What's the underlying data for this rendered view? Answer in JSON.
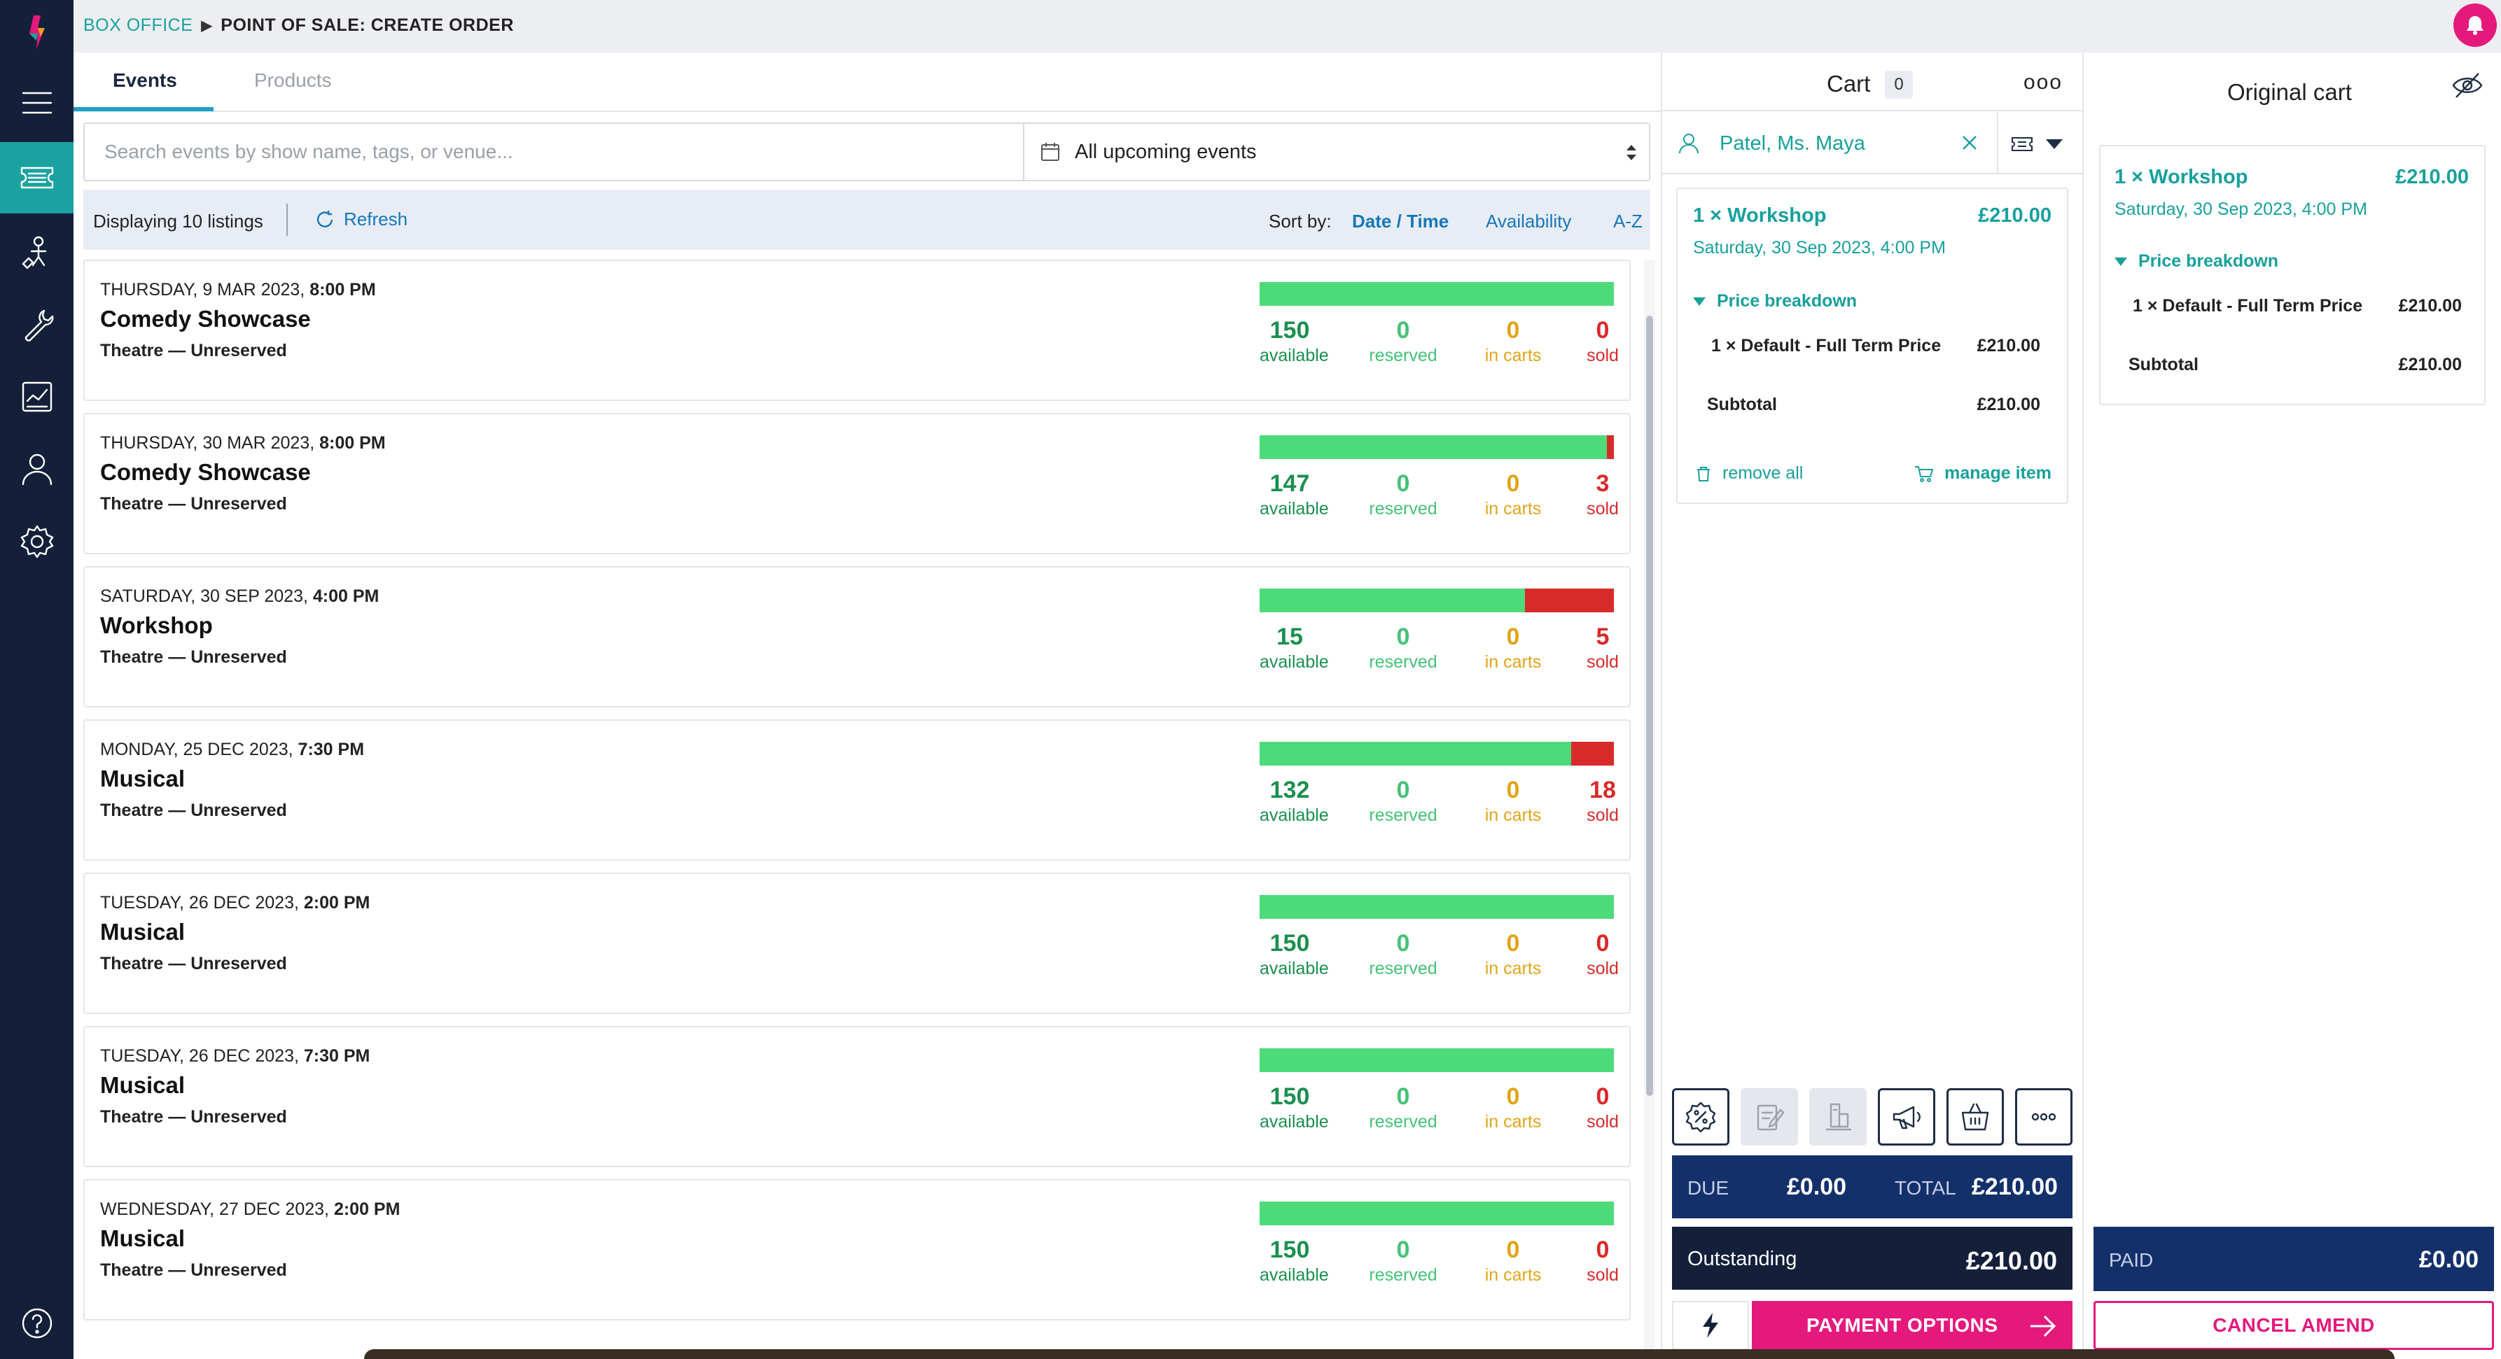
{
  "breadcrumb": {
    "section": "BOX OFFICE",
    "page": "POINT OF SALE: CREATE ORDER"
  },
  "tabs": [
    {
      "label": "Events"
    },
    {
      "label": "Products"
    }
  ],
  "search": {
    "placeholder": "Search events by show name, tags, or venue...",
    "value": ""
  },
  "filter": {
    "selected": "All upcoming events"
  },
  "listing": {
    "count_text": "Displaying 10 listings",
    "refresh_label": "Refresh"
  },
  "sort": {
    "label": "Sort by:",
    "options": [
      "Date / Time",
      "Availability",
      "A-Z"
    ],
    "selected": "Date / Time"
  },
  "stat_labels": {
    "available": "available",
    "reserved": "reserved",
    "in_carts": "in carts",
    "sold": "sold"
  },
  "events": [
    {
      "day": "THURSDAY, 9 MAR 2023,",
      "time": "8:00 PM",
      "name": "Comedy Showcase",
      "venue": "Theatre — Unreserved",
      "available": "150",
      "reserved": "0",
      "in_carts": "0",
      "sold": "0",
      "sold_fraction": 0
    },
    {
      "day": "THURSDAY, 30 MAR 2023,",
      "time": "8:00 PM",
      "name": "Comedy Showcase",
      "venue": "Theatre — Unreserved",
      "available": "147",
      "reserved": "0",
      "in_carts": "0",
      "sold": "3",
      "sold_fraction": 0.02
    },
    {
      "day": "SATURDAY, 30 SEP 2023,",
      "time": "4:00 PM",
      "name": "Workshop",
      "venue": "Theatre — Unreserved",
      "available": "15",
      "reserved": "0",
      "in_carts": "0",
      "sold": "5",
      "sold_fraction": 0.25
    },
    {
      "day": "MONDAY, 25 DEC 2023,",
      "time": "7:30 PM",
      "name": "Musical",
      "venue": "Theatre — Unreserved",
      "available": "132",
      "reserved": "0",
      "in_carts": "0",
      "sold": "18",
      "sold_fraction": 0.12
    },
    {
      "day": "TUESDAY, 26 DEC 2023,",
      "time": "2:00 PM",
      "name": "Musical",
      "venue": "Theatre — Unreserved",
      "available": "150",
      "reserved": "0",
      "in_carts": "0",
      "sold": "0",
      "sold_fraction": 0
    },
    {
      "day": "TUESDAY, 26 DEC 2023,",
      "time": "7:30 PM",
      "name": "Musical",
      "venue": "Theatre — Unreserved",
      "available": "150",
      "reserved": "0",
      "in_carts": "0",
      "sold": "0",
      "sold_fraction": 0
    },
    {
      "day": "WEDNESDAY, 27 DEC 2023,",
      "time": "2:00 PM",
      "name": "Musical",
      "venue": "Theatre — Unreserved",
      "available": "150",
      "reserved": "0",
      "in_carts": "0",
      "sold": "0",
      "sold_fraction": 0
    }
  ],
  "cart": {
    "title": "Cart",
    "count": "0",
    "customer": "Patel, Ms. Maya",
    "item": {
      "title": "1 × Workshop",
      "price": "£210.00",
      "date": "Saturday, 30 Sep 2023, 4:00 PM",
      "breakdown_label": "Price breakdown",
      "line_label": "1 × Default - Full Term Price",
      "line_price": "£210.00",
      "subtotal_label": "Subtotal",
      "subtotal_value": "£210.00",
      "remove_label": "remove all",
      "manage_label": "manage item"
    },
    "due_label": "DUE",
    "due_value": "£0.00",
    "total_label": "TOTAL",
    "total_value": "£210.00",
    "outstanding_label": "Outstanding",
    "outstanding_value": "£210.00",
    "payment_label": "PAYMENT OPTIONS"
  },
  "original_cart": {
    "title": "Original cart",
    "item": {
      "title": "1 × Workshop",
      "price": "£210.00",
      "date": "Saturday, 30 Sep 2023, 4:00 PM",
      "breakdown_label": "Price breakdown",
      "line_label": "1 × Default - Full Term Price",
      "line_price": "£210.00",
      "subtotal_label": "Subtotal",
      "subtotal_value": "£210.00"
    },
    "paid_label": "PAID",
    "paid_value": "£0.00",
    "cancel_label": "CANCEL AMEND"
  },
  "colors": {
    "accent": "#18a09b",
    "brand_pink": "#e5197c",
    "navy": "#14306b",
    "sidebar": "#14203a",
    "available_bar": "#4ddb7a",
    "sold_bar": "#d92a2a"
  }
}
